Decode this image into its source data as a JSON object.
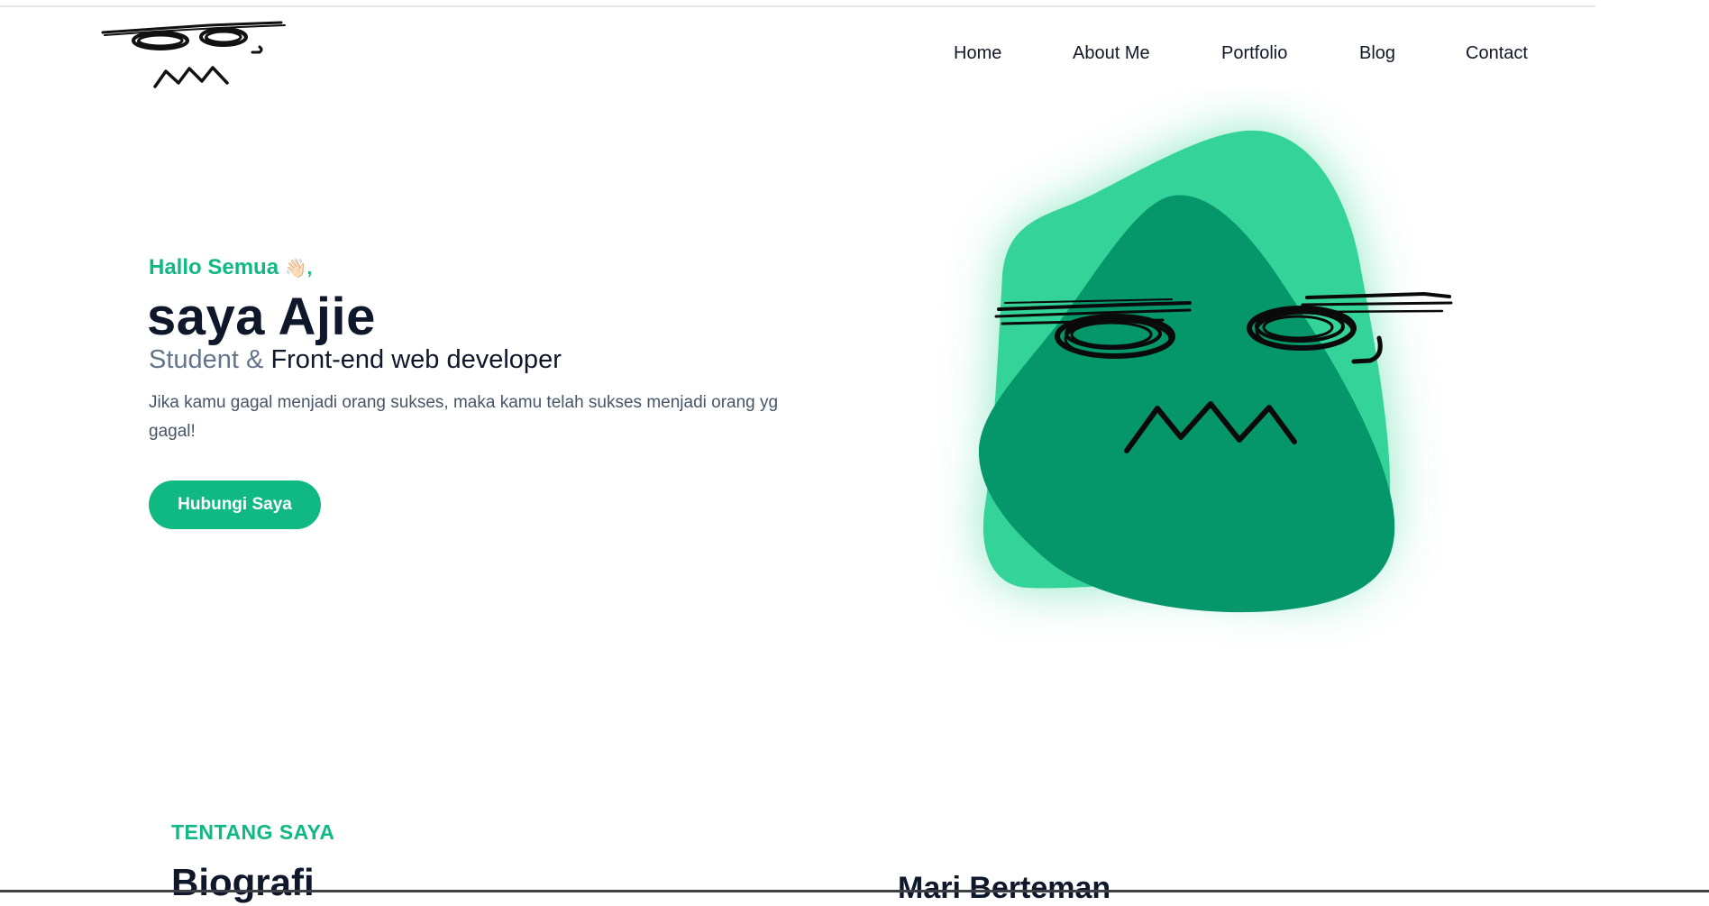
{
  "nav": {
    "items": [
      {
        "label": "Home"
      },
      {
        "label": "About Me"
      },
      {
        "label": "Portfolio"
      },
      {
        "label": "Blog"
      },
      {
        "label": "Contact"
      }
    ]
  },
  "hero": {
    "greeting": "Hallo Semua",
    "greeting_emoji": "👋🏻,",
    "name": "saya Ajie",
    "role_prefix": "Student &",
    "role_main": "Front-end web developer",
    "description": "Jika kamu gagal menjadi orang sukses, maka kamu telah sukses menjadi orang yg gagal!",
    "cta_label": "Hubungi Saya"
  },
  "about": {
    "label": "TENTANG SAYA",
    "title": "Biografi",
    "side_title": "Mari Berteman"
  },
  "icons": {
    "logo": "scribble-face-logo-icon",
    "hero_illustration": "scribble-face-blob-icon"
  },
  "colors": {
    "accent": "#10b981",
    "blob_light": "#34d399",
    "blob_dark": "#059669",
    "heading": "#0f172a",
    "muted": "#64748b"
  }
}
